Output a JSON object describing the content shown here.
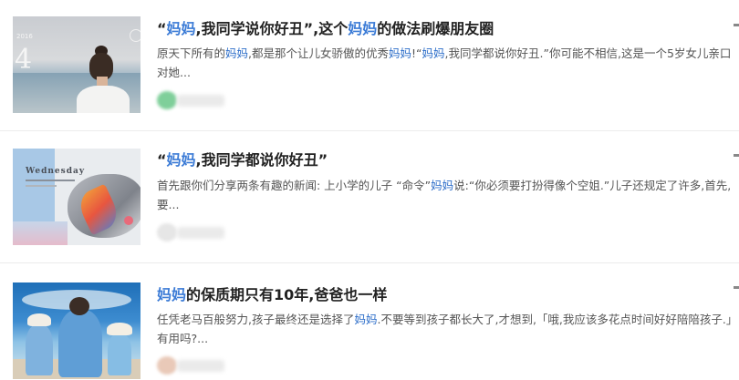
{
  "results": [
    {
      "title_parts": [
        {
          "text": "“",
          "hl": false
        },
        {
          "text": "妈妈",
          "hl": true
        },
        {
          "text": ",我同学说你好丑”,这个",
          "hl": false
        },
        {
          "text": "妈妈",
          "hl": true
        },
        {
          "text": "的做法刷爆朋友圈",
          "hl": false
        }
      ],
      "snippet_parts": [
        {
          "text": "原天下所有的",
          "hl": false
        },
        {
          "text": "妈妈",
          "hl": true
        },
        {
          "text": ",都是那个让儿女骄傲的优秀",
          "hl": false
        },
        {
          "text": "妈妈",
          "hl": true
        },
        {
          "text": "!“",
          "hl": false
        },
        {
          "text": "妈妈",
          "hl": true
        },
        {
          "text": ",我同学都说你好丑.”你可能不相信,这是一个5岁女儿亲口对她...",
          "hl": false
        }
      ],
      "thumb_num": "4",
      "thumb_label": "2016"
    },
    {
      "title_parts": [
        {
          "text": "“",
          "hl": false
        },
        {
          "text": "妈妈",
          "hl": true
        },
        {
          "text": ",我同学都说你好丑”",
          "hl": false
        }
      ],
      "snippet_parts": [
        {
          "text": "首先跟你们分享两条有趣的新闻: 上小学的儿子 “命令”",
          "hl": false
        },
        {
          "text": "妈妈",
          "hl": true
        },
        {
          "text": "说:“你必须要打扮得像个空姐.”儿子还规定了许多,首先,要...",
          "hl": false
        }
      ],
      "thumb_word": "Wednesday"
    },
    {
      "title_parts": [
        {
          "text": "妈妈",
          "hl": true
        },
        {
          "text": "的保质期只有10年,爸爸也一样",
          "hl": false
        }
      ],
      "snippet_parts": [
        {
          "text": "任凭老马百般努力,孩子最终还是选择了",
          "hl": false
        },
        {
          "text": "妈妈",
          "hl": true
        },
        {
          "text": ".不要等到孩子都长大了,才想到,「哦,我应该多花点时间好好陪陪孩子.」有用吗?...",
          "hl": false
        }
      ]
    }
  ],
  "source_avatar_colors": [
    "#7fcf9a",
    "#e6e6e6",
    "#e9c9b8"
  ]
}
